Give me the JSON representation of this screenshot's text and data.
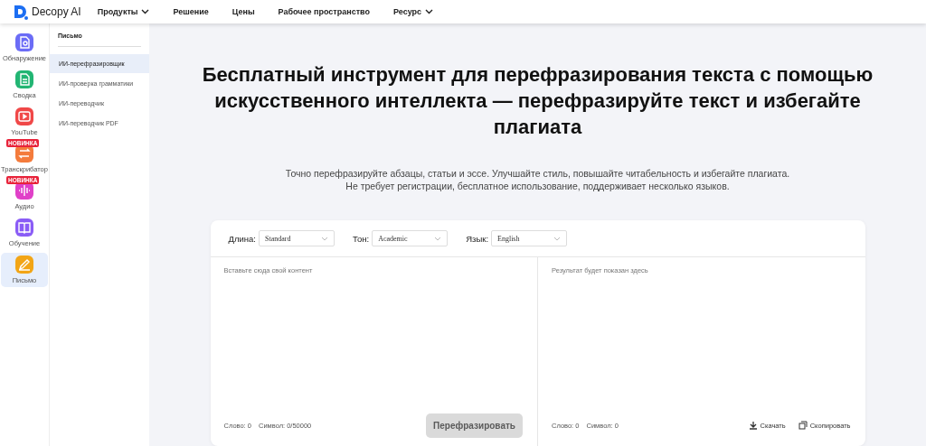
{
  "header": {
    "logo": "Decopy AI",
    "nav": [
      {
        "label": "Продукты",
        "dropdown": true
      },
      {
        "label": "Решение",
        "dropdown": false
      },
      {
        "label": "Цены",
        "dropdown": false
      },
      {
        "label": "Рабочее пространство",
        "dropdown": false
      },
      {
        "label": "Ресурс",
        "dropdown": true
      }
    ]
  },
  "rail": [
    {
      "label": "Обнаружение",
      "kind": "detect",
      "color": "#6b6cf6",
      "selected": false
    },
    {
      "label": "Сводка",
      "kind": "doc",
      "color": "#22b573",
      "selected": false
    },
    {
      "label": "YouTube",
      "kind": "video",
      "color": "#f04848",
      "selected": false
    },
    {
      "label": "Транскрибатор",
      "kind": "swap",
      "color": "#f47b3c",
      "badge": "НОВИНКА",
      "selected": false
    },
    {
      "label": "Аудио",
      "kind": "wave",
      "color": "#e040c8",
      "badge": "НОВИНКА",
      "selected": false
    },
    {
      "label": "Обучение",
      "kind": "book",
      "color": "#8a5cf6",
      "selected": false
    },
    {
      "label": "Письмо",
      "kind": "pen",
      "color": "#f2a516",
      "selected": true
    }
  ],
  "sidebar": {
    "title": "Письмо",
    "items": [
      {
        "label": "ИИ-перефразировщик",
        "selected": true
      },
      {
        "label": "ИИ-проверка грамматики",
        "selected": false
      },
      {
        "label": "ИИ-переводчик",
        "selected": false
      },
      {
        "label": "ИИ-переводчик PDF",
        "selected": false
      }
    ]
  },
  "hero": {
    "title": "Бесплатный инструмент для перефразирования текста с помощью искусственного интеллекта — перефразируйте текст и избегайте плагиата",
    "subtitle": "Точно перефразируйте абзацы, статьи и эссе. Улучшайте стиль, повышайте читабельность и избегайте плагиата. Не требует регистрации, бесплатное использование, поддерживает несколько языков."
  },
  "options": [
    {
      "label": "Длина:",
      "value": "Standard"
    },
    {
      "label": "Тон:",
      "value": "Academic"
    },
    {
      "label": "Язык:",
      "value": "English"
    }
  ],
  "input": {
    "placeholder": "Вставьте сюда свой контент",
    "words": "Слово: 0",
    "chars": "Символ: 0/50000",
    "button": {
      "label": "Перефразировать",
      "disabled": true
    }
  },
  "output": {
    "placeholder": "Результат будет показан здесь",
    "words": "Слово: 0",
    "chars": "Символ: 0",
    "actions": [
      {
        "label": "Скачать",
        "kind": "download"
      },
      {
        "label": "Скопировать",
        "kind": "copy"
      }
    ]
  }
}
